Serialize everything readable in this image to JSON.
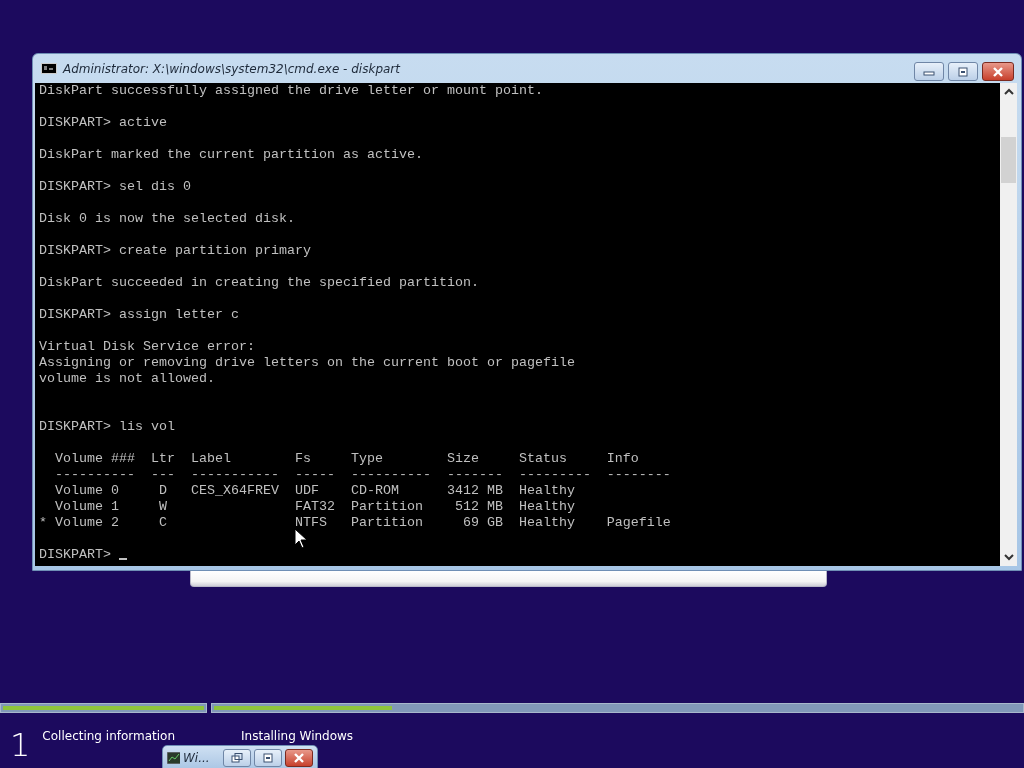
{
  "window": {
    "title": "Administrator: X:\\windows\\system32\\cmd.exe - diskpart"
  },
  "console": {
    "lines": [
      {
        "kind": "text",
        "text": "DiskPart successfully assigned the drive letter or mount point.",
        "cursor": false
      },
      {
        "kind": "blank"
      },
      {
        "kind": "text",
        "text": "DISKPART> active",
        "cursor": false
      },
      {
        "kind": "blank"
      },
      {
        "kind": "text",
        "text": "DiskPart marked the current partition as active.",
        "cursor": false
      },
      {
        "kind": "blank"
      },
      {
        "kind": "text",
        "text": "DISKPART> sel dis 0",
        "cursor": false
      },
      {
        "kind": "blank"
      },
      {
        "kind": "text",
        "text": "Disk 0 is now the selected disk.",
        "cursor": false
      },
      {
        "kind": "blank"
      },
      {
        "kind": "text",
        "text": "DISKPART> create partition primary",
        "cursor": false
      },
      {
        "kind": "blank"
      },
      {
        "kind": "text",
        "text": "DiskPart succeeded in creating the specified partition.",
        "cursor": false
      },
      {
        "kind": "blank"
      },
      {
        "kind": "text",
        "text": "DISKPART> assign letter c",
        "cursor": false
      },
      {
        "kind": "blank"
      },
      {
        "kind": "text",
        "text": "Virtual Disk Service error:",
        "cursor": false
      },
      {
        "kind": "text",
        "text": "Assigning or removing drive letters on the current boot or pagefile",
        "cursor": false
      },
      {
        "kind": "text",
        "text": "volume is not allowed.",
        "cursor": false
      },
      {
        "kind": "blank"
      },
      {
        "kind": "blank"
      },
      {
        "kind": "text",
        "text": "DISKPART> lis vol",
        "cursor": false
      },
      {
        "kind": "blank"
      },
      {
        "kind": "text",
        "text": "  Volume ###  Ltr  Label        Fs     Type        Size     Status     Info",
        "cursor": false
      },
      {
        "kind": "text",
        "text": "  ----------  ---  -----------  -----  ----------  -------  ---------  --------",
        "cursor": false
      },
      {
        "kind": "text",
        "text": "  Volume 0     D   CES_X64FREV  UDF    CD-ROM      3412 MB  Healthy",
        "cursor": false
      },
      {
        "kind": "text",
        "text": "  Volume 1     W                FAT32  Partition    512 MB  Healthy",
        "cursor": false
      },
      {
        "kind": "text",
        "text": "* Volume 2     C                NTFS   Partition     69 GB  Healthy    Pagefile",
        "cursor": false
      },
      {
        "kind": "blank"
      },
      {
        "kind": "text",
        "text": "DISKPART> ",
        "cursor": true
      }
    ]
  },
  "progress": [
    {
      "level": 1
    },
    {
      "level": 0.22
    }
  ],
  "steps": [
    {
      "number": "1",
      "label": "Collecting information"
    },
    {
      "label": "Installing Windows"
    }
  ],
  "minimized_window": {
    "title": "Wi..."
  }
}
